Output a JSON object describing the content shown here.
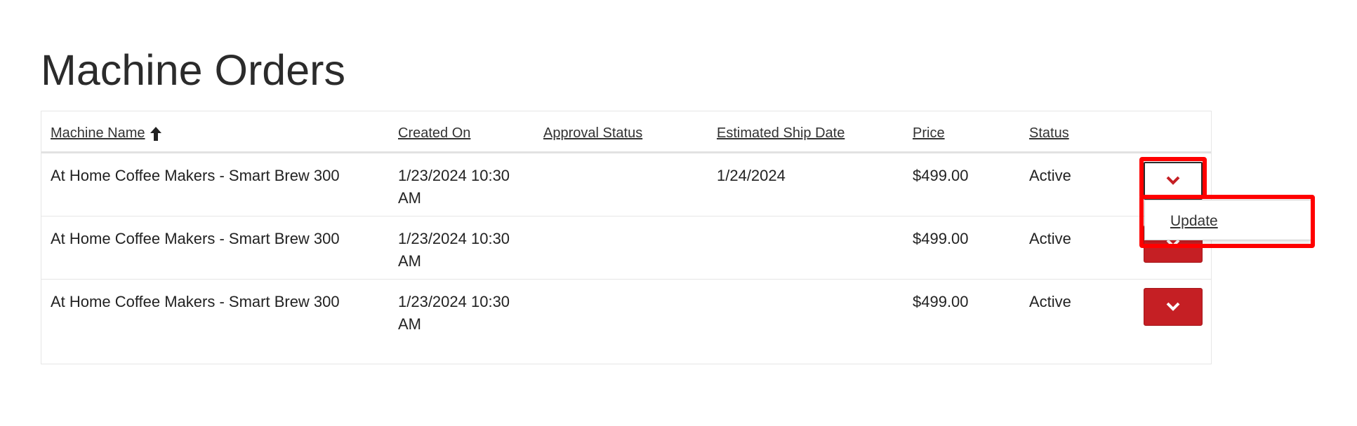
{
  "page": {
    "title": "Machine Orders"
  },
  "table": {
    "columns": [
      {
        "label": "Machine Name",
        "sorted": "ascending"
      },
      {
        "label": "Created On"
      },
      {
        "label": "Approval Status"
      },
      {
        "label": "Estimated Ship Date"
      },
      {
        "label": "Price"
      },
      {
        "label": "Status"
      }
    ],
    "rows": [
      {
        "machine_name": "At Home Coffee Makers - Smart Brew 300",
        "created_on": "1/23/2024 10:30 AM",
        "approval_status": "",
        "estimated_ship_date": "1/24/2024",
        "price": "$499.00",
        "status": "Active",
        "menu_open": true
      },
      {
        "machine_name": "At Home Coffee Makers - Smart Brew 300",
        "created_on": "1/23/2024 10:30 AM",
        "approval_status": "",
        "estimated_ship_date": "",
        "price": "$499.00",
        "status": "Active",
        "menu_open": false
      },
      {
        "machine_name": "At Home Coffee Makers - Smart Brew 300",
        "created_on": "1/23/2024 10:30 AM",
        "approval_status": "",
        "estimated_ship_date": "",
        "price": "$499.00",
        "status": "Active",
        "menu_open": false
      }
    ]
  },
  "dropdown": {
    "items": [
      {
        "label": "Update"
      }
    ]
  },
  "icons": {
    "sort": "arrow-up-icon",
    "row_menu": "chevron-down-icon"
  },
  "colors": {
    "accent": "#c51f24",
    "highlight": "#ff0000",
    "text": "#222222"
  }
}
